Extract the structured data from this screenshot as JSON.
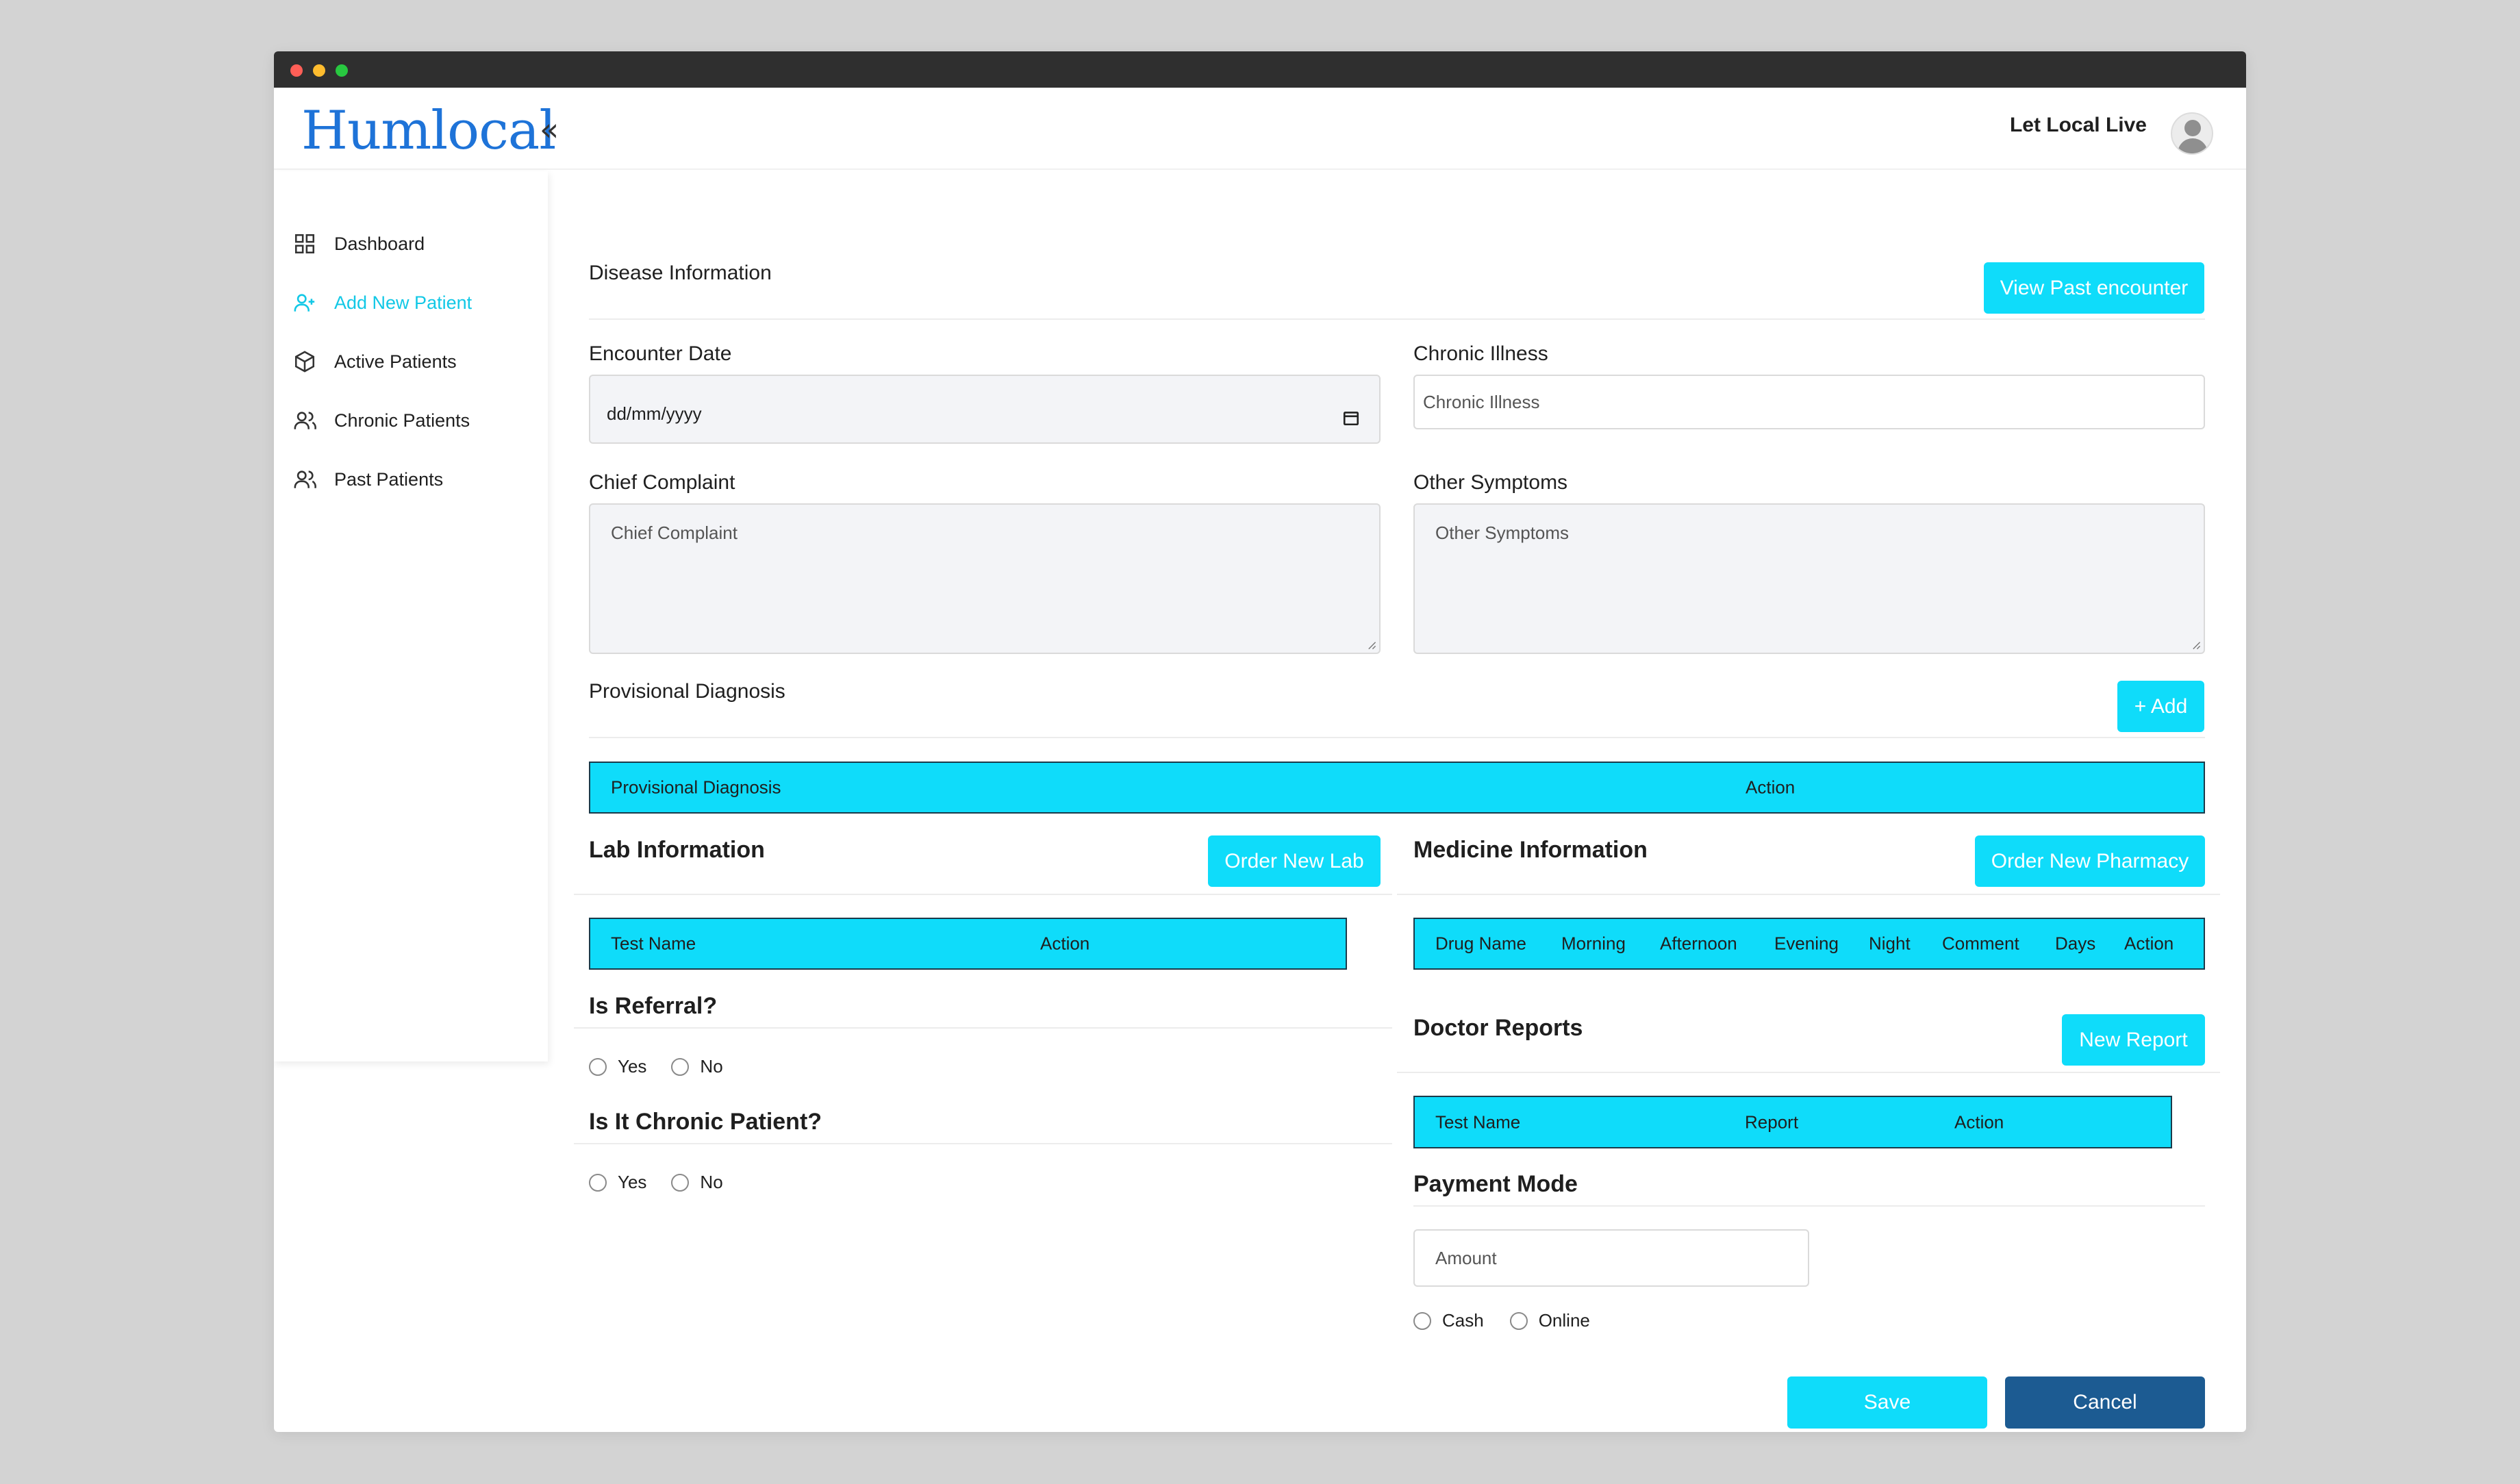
{
  "header": {
    "logo": "Humlocal",
    "collapse_icon": "«",
    "username": "Let Local Live"
  },
  "sidebar": {
    "items": [
      {
        "label": "Dashboard",
        "icon": "grid-icon"
      },
      {
        "label": "Add New Patient",
        "icon": "user-plus-icon",
        "active": true
      },
      {
        "label": "Active Patients",
        "icon": "box-icon"
      },
      {
        "label": "Chronic Patients",
        "icon": "users-icon"
      },
      {
        "label": "Past Patients",
        "icon": "users-icon"
      }
    ]
  },
  "disease": {
    "title": "Disease Information",
    "view_past_button": "View Past encounter",
    "encounter_date_label": "Encounter Date",
    "encounter_date_value": "dd/mm/yyyy",
    "chronic_illness_label": "Chronic Illness",
    "chronic_illness_placeholder": "Chronic Illness",
    "chief_complaint_label": "Chief Complaint",
    "chief_complaint_placeholder": "Chief Complaint",
    "other_symptoms_label": "Other Symptoms",
    "other_symptoms_placeholder": "Other Symptoms"
  },
  "provisional": {
    "title": "Provisional Diagnosis",
    "add_button": "+ Add",
    "columns": [
      "Provisional Diagnosis",
      "Action"
    ]
  },
  "lab": {
    "title": "Lab Information",
    "order_button": "Order New Lab",
    "columns": [
      "Test Name",
      "Action"
    ]
  },
  "medicine": {
    "title": "Medicine Information",
    "order_button": "Order New Pharmacy",
    "columns": [
      "Drug Name",
      "Morning",
      "Afternoon",
      "Evening",
      "Night",
      "Comment",
      "Days",
      "Action"
    ]
  },
  "referral": {
    "title": "Is Referral?",
    "options": [
      "Yes",
      "No"
    ]
  },
  "chronic": {
    "title": "Is It Chronic Patient?",
    "options": [
      "Yes",
      "No"
    ]
  },
  "reports": {
    "title": "Doctor Reports",
    "new_button": "New Report",
    "columns": [
      "Test Name",
      "Report",
      "Action"
    ]
  },
  "payment": {
    "title": "Payment Mode",
    "amount_placeholder": "Amount",
    "options": [
      "Cash",
      "Online"
    ]
  },
  "actions": {
    "save": "Save",
    "cancel": "Cancel"
  },
  "colors": {
    "accent": "#0fdcfa",
    "navy": "#1c5b92",
    "logo": "#1e73d8",
    "active_nav": "#12c8e6"
  }
}
